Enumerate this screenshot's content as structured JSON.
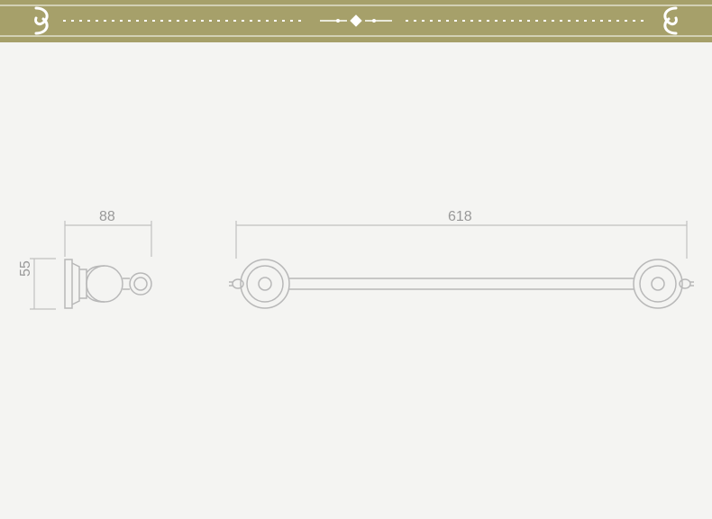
{
  "banner": {
    "bg_color": "#a6a06a",
    "fg_color": "#ffffff"
  },
  "drawing": {
    "bg_color": "#f4f4f2",
    "line_color": "#b8b8b8",
    "dim_line_color": "#c0c0c0",
    "label_color": "#999999"
  },
  "dimensions": {
    "width_side": "88",
    "height_side": "55",
    "length_front": "618"
  }
}
